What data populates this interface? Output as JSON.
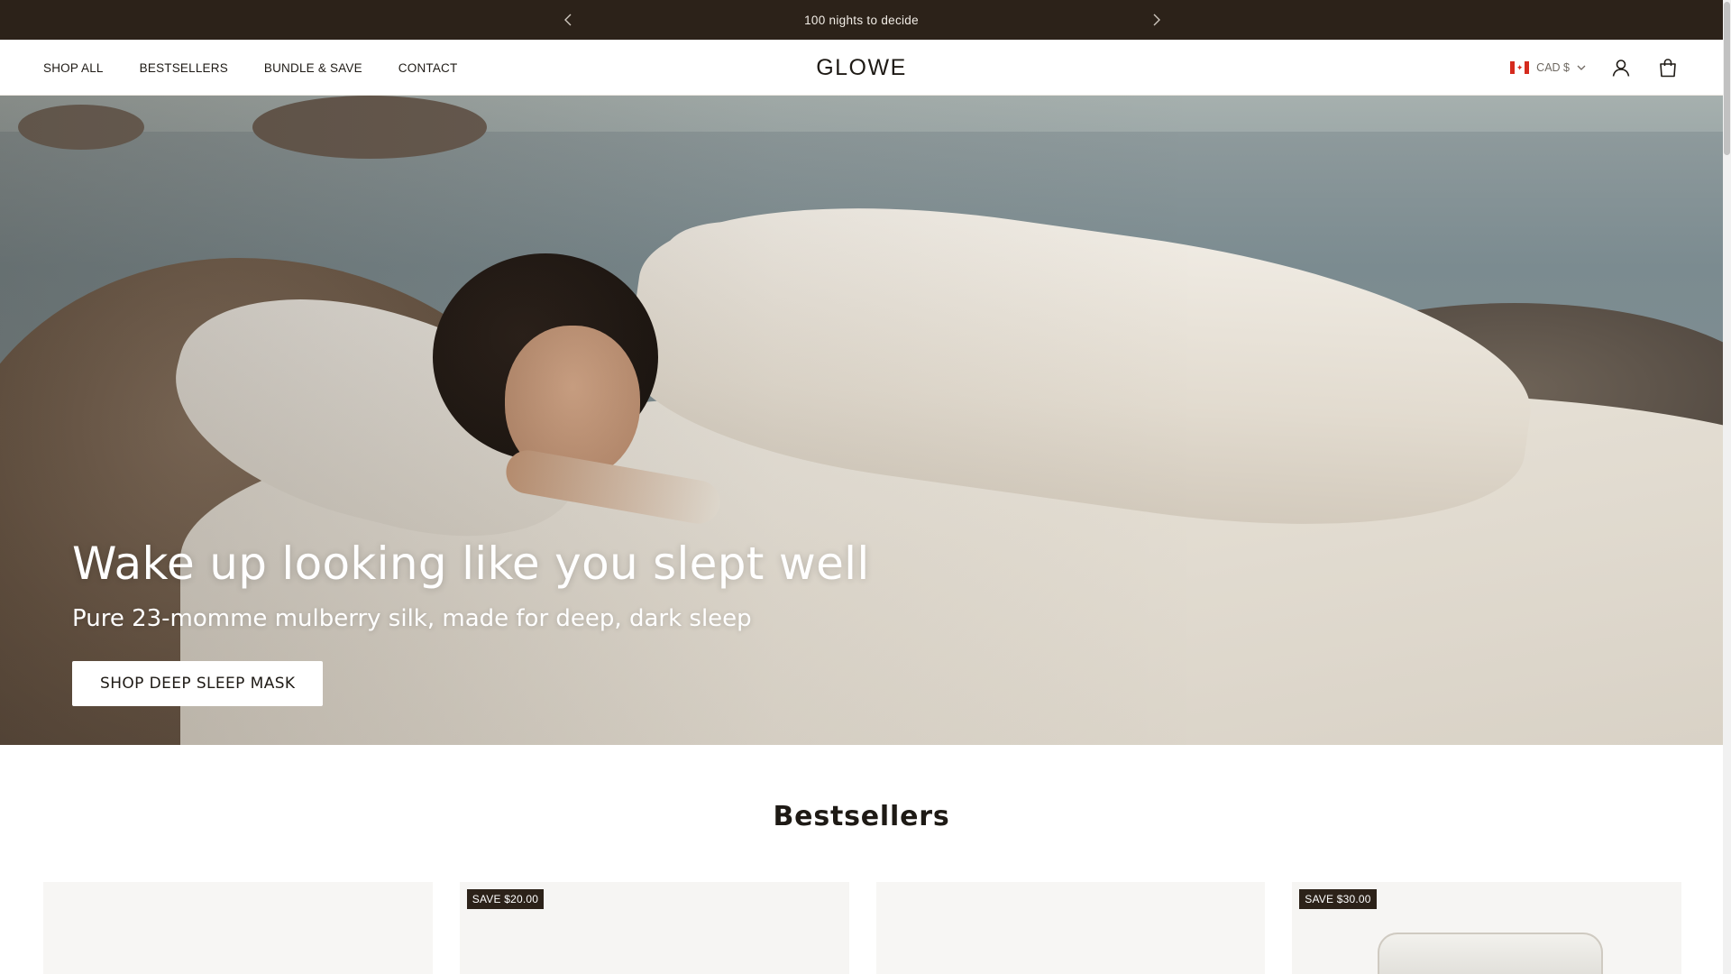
{
  "announcement": {
    "message": "100 nights to decide",
    "prev_icon": "chevron-left-icon",
    "next_icon": "chevron-right-icon"
  },
  "header": {
    "nav": [
      {
        "label": "SHOP ALL"
      },
      {
        "label": "BESTSELLERS"
      },
      {
        "label": "BUNDLE & SAVE"
      },
      {
        "label": "CONTACT"
      }
    ],
    "logo": "GLOWE",
    "currency": {
      "label": "CAD $",
      "flag": "canada-flag-icon"
    },
    "icons": [
      "user-account-icon",
      "shopping-bag-icon"
    ]
  },
  "hero": {
    "headline": "Wake up looking like you slept well",
    "subheadline": "Pure 23-momme mulberry silk, made for deep, dark sleep",
    "cta": "SHOP DEEP SLEEP MASK"
  },
  "bestsellers": {
    "title": "Bestsellers",
    "cards": [
      {
        "badge": ""
      },
      {
        "badge": "SAVE $20.00"
      },
      {
        "badge": ""
      },
      {
        "badge": "SAVE $30.00"
      }
    ]
  },
  "colors": {
    "announcement_bg": "#2c2219",
    "text": "#1e1a15",
    "badge_bg": "#2c2219"
  }
}
